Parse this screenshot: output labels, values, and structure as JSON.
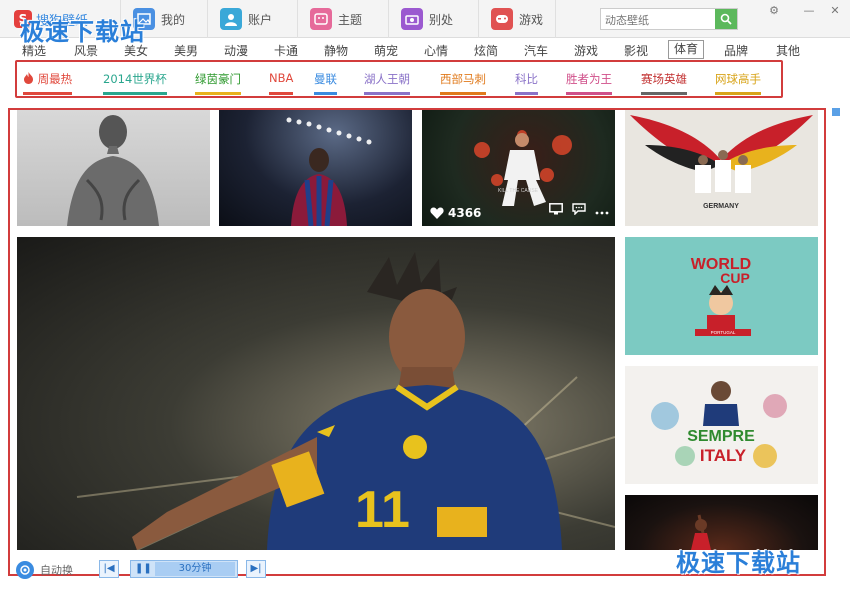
{
  "topbar": {
    "logo_text": "搜狗壁纸",
    "tabs": [
      {
        "label": "我的",
        "icon": "picture-icon",
        "color": "#4a90e2"
      },
      {
        "label": "账户",
        "icon": "user-icon",
        "color": "#3aa8d8"
      },
      {
        "label": "主题",
        "icon": "theme-icon",
        "color": "#e66a9a"
      },
      {
        "label": "别处",
        "icon": "camera-icon",
        "color": "#9b59d0"
      },
      {
        "label": "游戏",
        "icon": "gamepad-icon",
        "color": "#e05252"
      }
    ],
    "search_placeholder": "动态壁纸"
  },
  "watermark": "极速下载站",
  "categories": [
    "精选",
    "风景",
    "美女",
    "美男",
    "动漫",
    "卡通",
    "静物",
    "萌宠",
    "心情",
    "炫简",
    "汽车",
    "游戏",
    "影视",
    "体育",
    "品牌",
    "其他"
  ],
  "active_category": "体育",
  "subtags": [
    {
      "label": "周最热",
      "color": "#e0483c",
      "underline": "#e0483c"
    },
    {
      "label": "2014世界杯",
      "color": "#2aa68e",
      "underline": "#2aa68e"
    },
    {
      "label": "绿茵豪门",
      "color": "#2f9a2f",
      "underline": "#e8b21d"
    },
    {
      "label": "NBA",
      "color": "#e0483c",
      "underline": "#e0483c"
    },
    {
      "label": "曼联",
      "color": "#3a8be0",
      "underline": "#3a8be0"
    },
    {
      "label": "湖人王朝",
      "color": "#8a72c8",
      "underline": "#8a72c8"
    },
    {
      "label": "西部马刺",
      "color": "#e07a1c",
      "underline": "#e07a1c"
    },
    {
      "label": "科比",
      "color": "#8a72c8",
      "underline": "#8a72c8"
    },
    {
      "label": "胜者为王",
      "color": "#d0508a",
      "underline": "#d0508a"
    },
    {
      "label": "赛场英雄",
      "color": "#c23030",
      "underline": "#666666"
    },
    {
      "label": "网球高手",
      "color": "#d8a41a",
      "underline": "#d8a41a"
    }
  ],
  "tiles": {
    "likes": "4366",
    "tile3_caption": "KILL THE CAUSE",
    "worldcup_title": "WORLD",
    "worldcup_title2": "CUP",
    "worldcup_sub": "PORTUGAL",
    "italy_big": "SEMPRE",
    "italy_big2": "ITALY",
    "germany_caption": "GERMANY"
  },
  "controls": {
    "auto_label": "自动换",
    "interval": "30分钟"
  }
}
